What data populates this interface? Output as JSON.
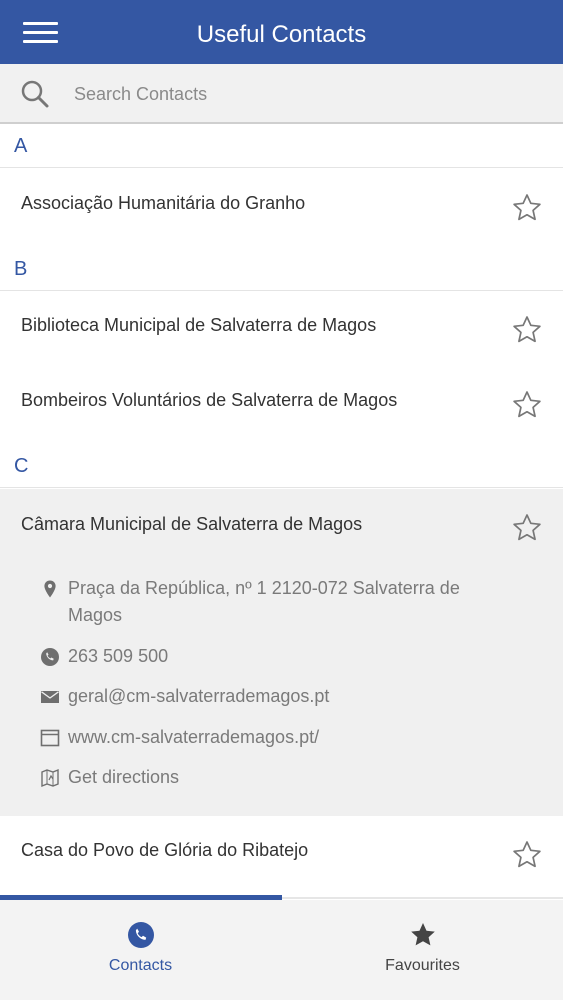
{
  "app_bar": {
    "title": "Useful Contacts",
    "menu_icon": "hamburger-menu-icon"
  },
  "search": {
    "placeholder": "Search Contacts",
    "value": "",
    "icon": "search-icon"
  },
  "sections": [
    {
      "letter": "A",
      "contacts": [
        {
          "name": "Associação Humanitária do Granho",
          "favourite": false
        }
      ]
    },
    {
      "letter": "B",
      "contacts": [
        {
          "name": "Biblioteca Municipal de Salvaterra de Magos",
          "favourite": false
        },
        {
          "name": "Bombeiros Voluntários de Salvaterra de Magos",
          "favourite": false
        }
      ]
    },
    {
      "letter": "C",
      "contacts": [
        {
          "name": "Câmara Municipal de Salvaterra de Magos",
          "favourite": false,
          "expanded": true,
          "details": {
            "address_line1": "Praça da República, nº 1 2120-072 Salvaterra de",
            "address_line2": "Magos",
            "phone": "263 509 500",
            "email": "geral@cm-salvaterrademagos.pt",
            "website": "www.cm-salvaterrademagos.pt/",
            "directions": "Get directions"
          }
        },
        {
          "name": "Casa do Povo de Glória do Ribatejo",
          "favourite": false
        }
      ]
    }
  ],
  "tabs": [
    {
      "label": "Contacts",
      "icon": "phone-icon",
      "active": true
    },
    {
      "label": "Favourites",
      "icon": "star-icon",
      "active": false
    }
  ],
  "colors": {
    "primary": "#3457a3",
    "expanded_bg": "#f0f0f0",
    "muted_text": "#7a7a7a",
    "tab_inactive": "#444444"
  }
}
